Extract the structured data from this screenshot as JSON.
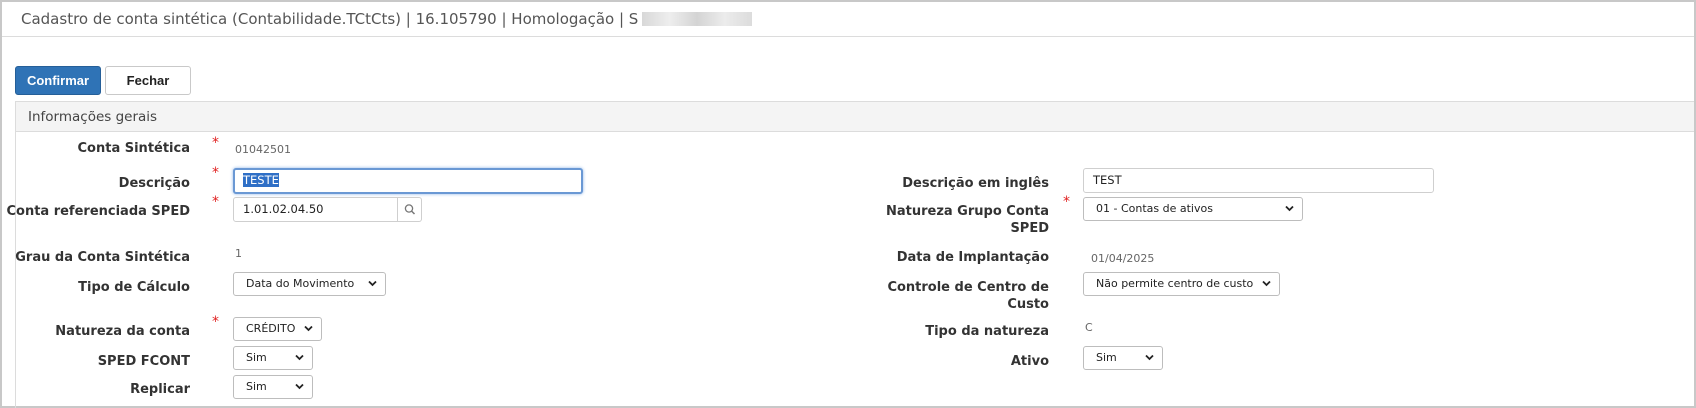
{
  "window": {
    "title": "Cadastro de conta sintética (Contabilidade.TCtCts) | 16.105790 | Homologação | S"
  },
  "toolbar": {
    "confirm_label": "Confirmar",
    "close_label": "Fechar"
  },
  "section": {
    "title": "Informações gerais"
  },
  "fields": {
    "conta_sintetica": {
      "label": "Conta Sintética",
      "value": "01042501"
    },
    "descricao": {
      "label": "Descrição",
      "value": "TESTE"
    },
    "conta_sped": {
      "label": "Conta referenciada SPED",
      "value": "1.01.02.04.50"
    },
    "grau": {
      "label": "Grau da Conta Sintética",
      "value": "1"
    },
    "tipo_calculo": {
      "label": "Tipo de Cálculo",
      "value": "Data do Movimento"
    },
    "natureza_conta": {
      "label": "Natureza da conta",
      "value": "CRÉDITO"
    },
    "sped_fcont": {
      "label": "SPED FCONT",
      "value": "Sim"
    },
    "replicar": {
      "label": "Replicar",
      "value": "Sim"
    },
    "descricao_ingles": {
      "label": "Descrição em inglês",
      "value": "TEST"
    },
    "natureza_grupo": {
      "label_line1": "Natureza Grupo Conta",
      "label_line2": "SPED",
      "value": "01 - Contas de ativos"
    },
    "data_implantacao": {
      "label": "Data de Implantação",
      "value": "01/04/2025"
    },
    "controle_centro": {
      "label_line1": "Controle de Centro de",
      "label_line2": "Custo",
      "value": "Não permite centro de custo"
    },
    "tipo_natureza": {
      "label": "Tipo da natureza",
      "value": "C"
    },
    "ativo": {
      "label": "Ativo",
      "value": "Sim"
    }
  },
  "required_marker": "*",
  "icons": {
    "lookup": "search-icon",
    "dropdown": "chevron-down-icon"
  },
  "colors": {
    "primary_button": "#2f73b6",
    "required": "#e02020",
    "focus_border": "#6a98d4"
  }
}
